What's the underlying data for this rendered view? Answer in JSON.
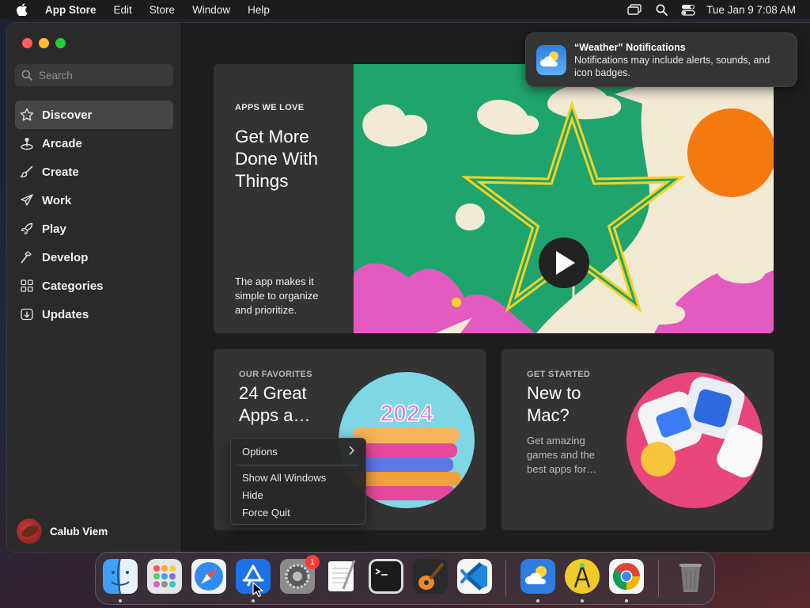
{
  "menubar": {
    "app_name": "App Store",
    "items": [
      "Edit",
      "Store",
      "Window",
      "Help"
    ],
    "clock": "Tue Jan 9  7:08 AM"
  },
  "sidebar": {
    "search_placeholder": "Search",
    "items": [
      {
        "label": "Discover",
        "icon": "star-icon",
        "active": true
      },
      {
        "label": "Arcade",
        "icon": "joystick-icon"
      },
      {
        "label": "Create",
        "icon": "brush-icon"
      },
      {
        "label": "Work",
        "icon": "paper-plane-icon"
      },
      {
        "label": "Play",
        "icon": "rocket-icon"
      },
      {
        "label": "Develop",
        "icon": "hammer-icon"
      },
      {
        "label": "Categories",
        "icon": "grid-icon"
      },
      {
        "label": "Updates",
        "icon": "download-icon"
      }
    ],
    "account_name": "Calub Viem"
  },
  "hero": {
    "eyebrow": "APPS WE LOVE",
    "title": "Get More Done With Things",
    "description": "The app makes it simple to organize and prioritize."
  },
  "cards": [
    {
      "eyebrow": "OUR FAVORITES",
      "title": "24 Great Apps a…",
      "art_text": "2024"
    },
    {
      "eyebrow": "GET STARTED",
      "title": "New to Mac?",
      "description": "Get amazing games and the best apps for…"
    }
  ],
  "context_menu": {
    "items": [
      "Options",
      "Show All Windows",
      "Hide",
      "Force Quit"
    ]
  },
  "notification": {
    "title": "“Weather” Notifications",
    "body": "Notifications may include alerts, sounds, and icon badges."
  },
  "dock": {
    "settings_badge": "1",
    "apps": [
      "Finder",
      "Launchpad",
      "Safari",
      "App Store",
      "System Settings",
      "TextEdit",
      "Terminal",
      "GarageBand",
      "Visual Studio Code",
      "Weather",
      "Android Studio",
      "Google Chrome",
      "Trash"
    ]
  },
  "colors": {
    "accent_green": "#27a86b",
    "accent_pink": "#e35bc0",
    "accent_orange": "#f47a10",
    "star_yellow": "#f3d324"
  }
}
